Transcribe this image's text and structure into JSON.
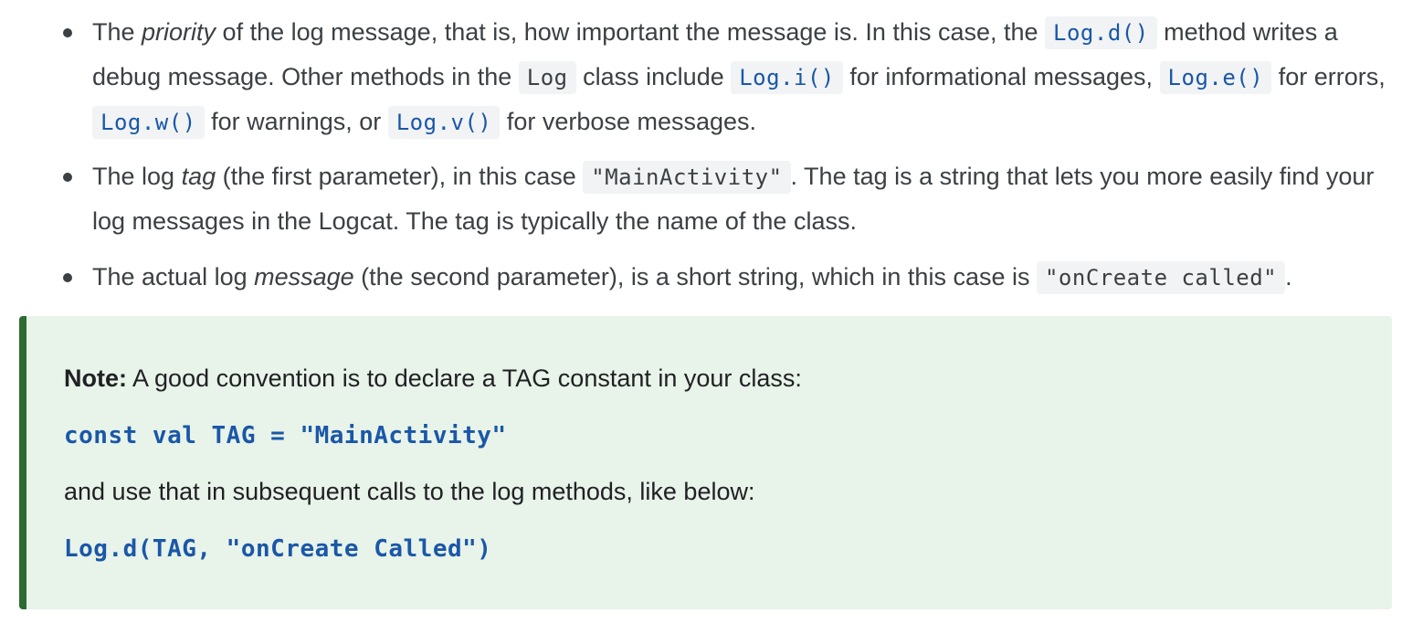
{
  "bullets": [
    {
      "parts": {
        "t1": "The ",
        "em1": "priority",
        "t2": " of the log message, that is, how important the message is. In this case, the ",
        "c1": "Log.d()",
        "t3": " method writes a debug message. Other methods in the ",
        "c2": "Log",
        "t4": " class include ",
        "c3": "Log.i()",
        "t5": " for informational messages, ",
        "c4": "Log.e()",
        "t6": " for errors, ",
        "c5": "Log.w()",
        "t7": " for warnings, or ",
        "c6": "Log.v()",
        "t8": " for verbose messages."
      }
    },
    {
      "parts": {
        "t1": "The log ",
        "em1": "tag",
        "t2": " (the first parameter), in this case ",
        "c1": "\"MainActivity\"",
        "t3": ". The tag is a string that lets you more easily find your log messages in the Logcat. The tag is typically the name of the class."
      }
    },
    {
      "parts": {
        "t1": "The actual log ",
        "em1": "message",
        "t2": " (the second parameter), is a short string, which in this case is ",
        "c1": "\"onCreate called\"",
        "t3": "."
      }
    }
  ],
  "note": {
    "label": "Note:",
    "line1": " A good convention is to declare a TAG constant in your class:",
    "code1": "const val TAG = \"MainActivity\"",
    "line2": "and use that in subsequent calls to the log methods, like below:",
    "code2": "Log.d(TAG, \"onCreate Called\")"
  },
  "colors": {
    "text": "#3c4043",
    "code_blue": "#1a57a8",
    "code_background": "#f1f3f4",
    "note_background": "#e8f3e9",
    "note_border": "#2e6b32"
  }
}
